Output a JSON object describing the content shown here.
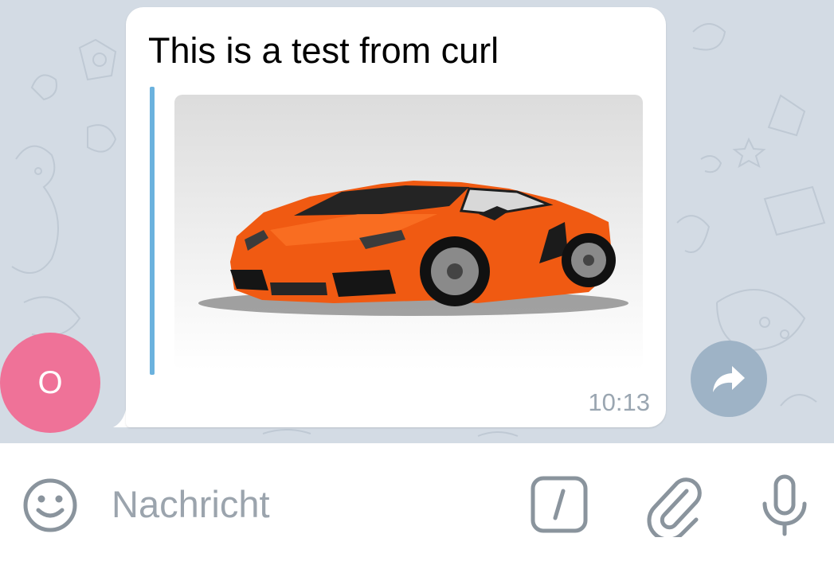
{
  "message": {
    "sender_initial": "O",
    "text": "This is a test from curl",
    "time": "10:13"
  },
  "input": {
    "placeholder": "Nachricht"
  },
  "icons": {
    "avatar_color": "#ef7298",
    "quote_bar_color": "#6bb2de",
    "share": "share-icon",
    "emoji": "smiley-icon",
    "commands": "slash-command-icon",
    "attach": "paperclip-icon",
    "mic": "microphone-icon"
  },
  "colors": {
    "chat_background": "#d3dbe4",
    "car": "#f05a12"
  }
}
